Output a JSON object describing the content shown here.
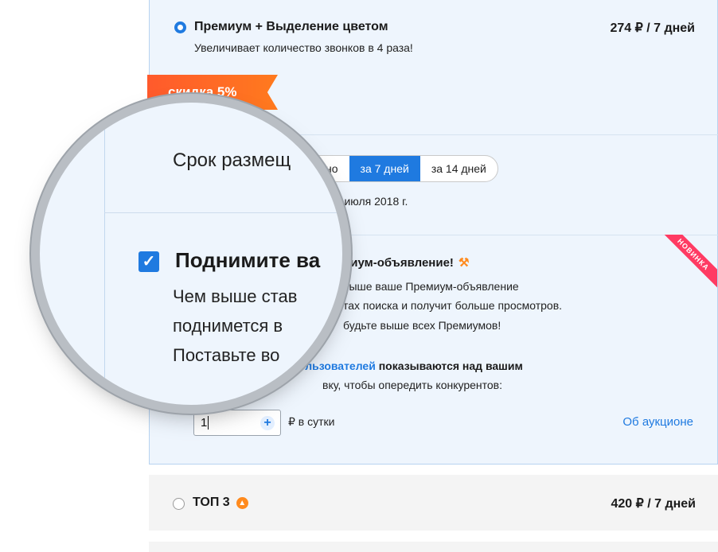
{
  "premium_option": {
    "title": "Премиум + Выделение цветом",
    "subtitle": "Увеличивает количество звонков в 4 раза!",
    "price": "274 ₽ / 7 дней"
  },
  "discount": {
    "label": "скидка 5%"
  },
  "duration": {
    "label": "Срок размещ",
    "options": [
      "но",
      "за 7 дней",
      "за 14 дней"
    ],
    "selected": "за 7 дней",
    "until_text": "13 июля 2018 г."
  },
  "auction": {
    "checkbox_checked": true,
    "title_zoomed": "Поднимите ва",
    "title_rest": "емиум-объявление!",
    "badge": "НОВИНКА",
    "zoom_line1": "Чем выше став",
    "zoom_line2": "поднимется в",
    "zoom_line3": "Поставьте во",
    "line1": "выше ваше Премиум-объявление",
    "line2": "тах поиска и получит больше просмотров.",
    "line3": "будьте выше всех Премиумов!",
    "users_link": "ользователей",
    "users_rest": " показываются над вашим",
    "line5": "вку, чтобы опередить конкурентов:",
    "bid_value": "1",
    "per_day": "₽ в сутки",
    "about_link": "Об аукционе"
  },
  "top3_option": {
    "title": "ТОП 3",
    "price": "420 ₽ / 7 дней"
  },
  "colors": {
    "accent": "#1f7ae0",
    "discount": "#ff6a24",
    "badge": "#ff3b63",
    "card_bg": "#eef5fd"
  }
}
